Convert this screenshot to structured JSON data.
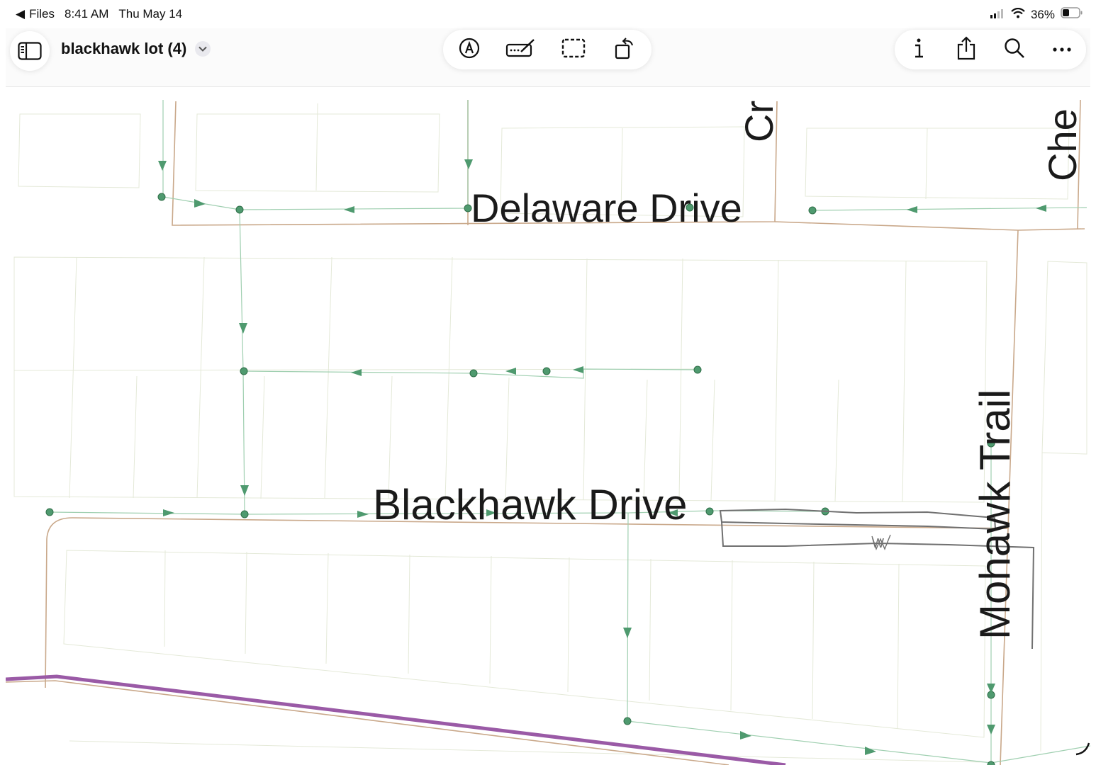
{
  "status": {
    "back_label": "Files",
    "time": "8:41 AM",
    "date": "Thu May 14",
    "battery": "36%"
  },
  "document": {
    "title": "blackhawk lot (4)"
  },
  "icons": {
    "sidebar": "sidebar-icon",
    "chevron": "chevron-down-icon",
    "markup": "markup-pen-icon",
    "signature": "signature-icon",
    "select": "selection-icon",
    "rotate": "rotate-icon",
    "info": "info-icon",
    "share": "share-icon",
    "search": "search-icon",
    "more": "more-icon"
  },
  "map": {
    "streets": {
      "delaware": "Delaware Drive",
      "blackhawk": "Blackhawk Drive",
      "mohawk": "Mohawk Trail",
      "cr_top": "Cr",
      "che_top": "Che"
    },
    "handwritten_note": "W",
    "colors": {
      "property_line": "#c9a88a",
      "sewer": "#4f9a6f",
      "railway": "#9a5aa6",
      "lot": "#e4e9d8",
      "pen": "#707070"
    }
  }
}
